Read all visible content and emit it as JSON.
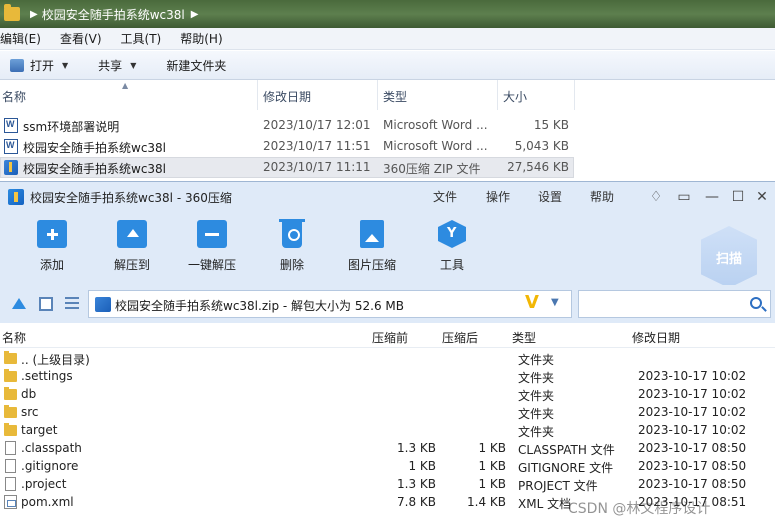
{
  "explorer": {
    "breadcrumb": "校园安全随手拍系统wc38l",
    "menu": [
      "编辑(E)",
      "查看(V)",
      "工具(T)",
      "帮助(H)"
    ],
    "toolbar": {
      "open": "打开",
      "share": "共享",
      "new_folder": "新建文件夹"
    },
    "columns": {
      "name": "名称",
      "modified": "修改日期",
      "type": "类型",
      "size": "大小"
    },
    "files": [
      {
        "name": "ssm环境部署说明",
        "modified": "2023/10/17 12:01",
        "type": "Microsoft Word ...",
        "size": "15 KB",
        "icon": "word-doc-icon"
      },
      {
        "name": "校园安全随手拍系统wc38l",
        "modified": "2023/10/17 11:51",
        "type": "Microsoft Word ...",
        "size": "5,043 KB",
        "icon": "word-doc-icon"
      },
      {
        "name": "校园安全随手拍系统wc38l",
        "modified": "2023/10/17 11:11",
        "type": "360压缩 ZIP 文件",
        "size": "27,546 KB",
        "icon": "zip-icon",
        "selected": true
      }
    ]
  },
  "zip_window": {
    "title": "校园安全随手拍系统wc38l - 360压缩",
    "menu": [
      "文件",
      "操作",
      "设置",
      "帮助"
    ],
    "tools": [
      "添加",
      "解压到",
      "一键解压",
      "删除",
      "图片压缩",
      "工具"
    ],
    "scan_label": "扫描",
    "path_text": "校园安全随手拍系统wc38l.zip - 解包大小为 52.6 MB",
    "search_placeholder": "",
    "columns": {
      "name": "名称",
      "compressed": "压缩前",
      "after": "压缩后",
      "type": "类型",
      "modified": "修改日期"
    },
    "rows": [
      {
        "name": ".. (上级目录)",
        "before": "",
        "after": "",
        "type": "文件夹",
        "modified": "",
        "icon": "folder-icon"
      },
      {
        "name": ".settings",
        "before": "",
        "after": "",
        "type": "文件夹",
        "modified": "2023-10-17 10:02",
        "icon": "folder-icon"
      },
      {
        "name": "db",
        "before": "",
        "after": "",
        "type": "文件夹",
        "modified": "2023-10-17 10:02",
        "icon": "folder-icon"
      },
      {
        "name": "src",
        "before": "",
        "after": "",
        "type": "文件夹",
        "modified": "2023-10-17 10:02",
        "icon": "folder-icon"
      },
      {
        "name": "target",
        "before": "",
        "after": "",
        "type": "文件夹",
        "modified": "2023-10-17 10:02",
        "icon": "folder-icon"
      },
      {
        "name": ".classpath",
        "before": "1.3 KB",
        "after": "1 KB",
        "type": "CLASSPATH 文件",
        "modified": "2023-10-17 08:50",
        "icon": "file-icon"
      },
      {
        "name": ".gitignore",
        "before": "1 KB",
        "after": "1 KB",
        "type": "GITIGNORE 文件",
        "modified": "2023-10-17 08:50",
        "icon": "file-icon"
      },
      {
        "name": ".project",
        "before": "1.3 KB",
        "after": "1 KB",
        "type": "PROJECT 文件",
        "modified": "2023-10-17 08:50",
        "icon": "file-icon"
      },
      {
        "name": "pom.xml",
        "before": "7.8 KB",
        "after": "1.4 KB",
        "type": "XML 文档",
        "modified": "2023-10-17 08:51",
        "icon": "xml-file-icon"
      }
    ]
  },
  "watermark": "CSDN @林文程序设计"
}
